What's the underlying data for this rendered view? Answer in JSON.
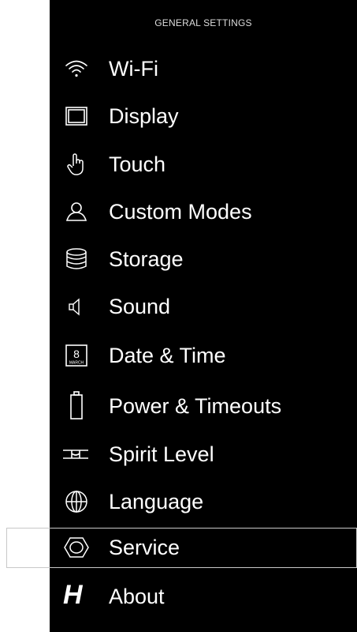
{
  "header": {
    "title": "GENERAL SETTINGS"
  },
  "menu": [
    {
      "label": "Wi-Fi",
      "icon": "wifi-icon"
    },
    {
      "label": "Display",
      "icon": "display-icon"
    },
    {
      "label": "Touch",
      "icon": "touch-hand-icon"
    },
    {
      "label": "Custom Modes",
      "icon": "user-icon"
    },
    {
      "label": "Storage",
      "icon": "storage-icon"
    },
    {
      "label": "Sound",
      "icon": "speaker-icon"
    },
    {
      "label": "Date & Time",
      "icon": "calendar-icon",
      "icon_text": {
        "day": "8",
        "month": "MARCH"
      }
    },
    {
      "label": "Power & Timeouts",
      "icon": "battery-icon"
    },
    {
      "label": "Spirit Level",
      "icon": "spirit-level-icon"
    },
    {
      "label": "Language",
      "icon": "globe-icon"
    },
    {
      "label": "Service",
      "icon": "hexagon-nut-icon",
      "selected": true
    },
    {
      "label": "About",
      "icon": "brand-h-logo-icon",
      "icon_text": "H"
    }
  ],
  "colors": {
    "background": "#000000",
    "text": "#ffffff",
    "header_text": "#dcdcdc",
    "selection_border": "#c8c8c8"
  }
}
